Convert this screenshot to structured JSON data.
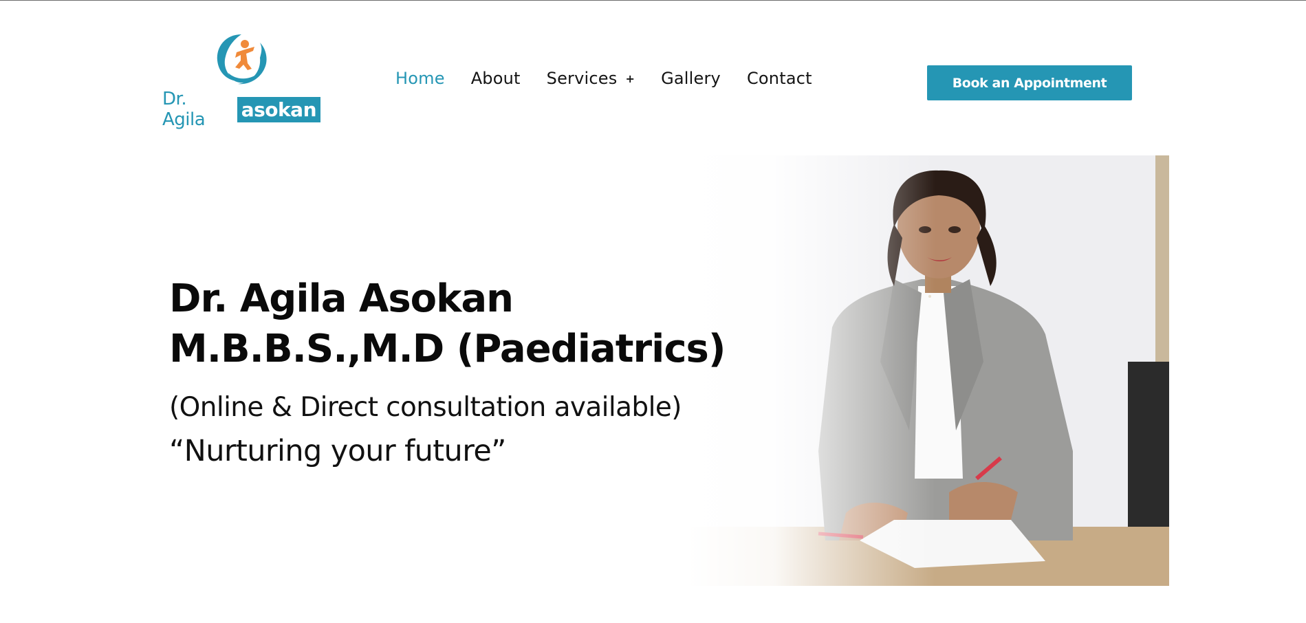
{
  "brand": {
    "logo_prefix": "Dr. Agila",
    "logo_highlight": "asokan",
    "accent_color": "#2596b4",
    "orange_color": "#f08a3a",
    "logo_icon": "child-in-hands-icon"
  },
  "nav": {
    "items": [
      {
        "label": "Home",
        "active": true
      },
      {
        "label": "About"
      },
      {
        "label": "Services",
        "expand_icon": "+"
      },
      {
        "label": "Gallery"
      },
      {
        "label": "Contact"
      }
    ],
    "cta_label": "Book an Appointment"
  },
  "hero": {
    "name": "Dr. Agila Asokan",
    "degree": "M.B.B.S.,M.D (Paediatrics)",
    "consultation": "(Online & Direct consultation available)",
    "tagline": "“Nurturing your future”",
    "photo_subject": "doctor-portrait"
  }
}
